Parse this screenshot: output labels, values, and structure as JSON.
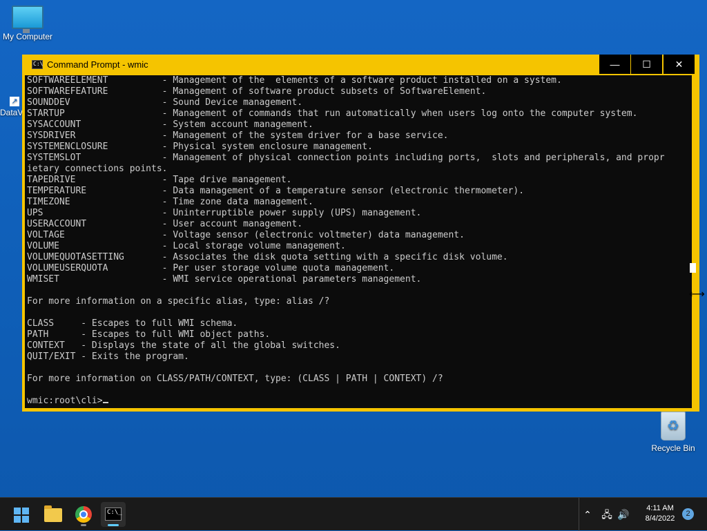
{
  "desktop": {
    "my_computer_label": "My Computer",
    "recycle_bin_label": "Recycle Bin",
    "data_label": "DataV"
  },
  "window": {
    "title": "Command Prompt - wmic",
    "minimize_glyph": "—",
    "maximize_glyph": "☐",
    "close_glyph": "✕"
  },
  "console": {
    "lines": [
      "SOFTWAREELEMENT          - Management of the  elements of a software product installed on a system.",
      "SOFTWAREFEATURE          - Management of software product subsets of SoftwareElement.",
      "SOUNDDEV                 - Sound Device management.",
      "STARTUP                  - Management of commands that run automatically when users log onto the computer system.",
      "SYSACCOUNT               - System account management.",
      "SYSDRIVER                - Management of the system driver for a base service.",
      "SYSTEMENCLOSURE          - Physical system enclosure management.",
      "SYSTEMSLOT               - Management of physical connection points including ports,  slots and peripherals, and propr",
      "ietary connections points.",
      "TAPEDRIVE                - Tape drive management.",
      "TEMPERATURE              - Data management of a temperature sensor (electronic thermometer).",
      "TIMEZONE                 - Time zone data management.",
      "UPS                      - Uninterruptible power supply (UPS) management.",
      "USERACCOUNT              - User account management.",
      "VOLTAGE                  - Voltage sensor (electronic voltmeter) data management.",
      "VOLUME                   - Local storage volume management.",
      "VOLUMEQUOTASETTING       - Associates the disk quota setting with a specific disk volume.",
      "VOLUMEUSERQUOTA          - Per user storage volume quota management.",
      "WMISET                   - WMI service operational parameters management.",
      "",
      "For more information on a specific alias, type: alias /?",
      "",
      "CLASS     - Escapes to full WMI schema.",
      "PATH      - Escapes to full WMI object paths.",
      "CONTEXT   - Displays the state of all the global switches.",
      "QUIT/EXIT - Exits the program.",
      "",
      "For more information on CLASS/PATH/CONTEXT, type: (CLASS | PATH | CONTEXT) /?",
      ""
    ],
    "prompt": "wmic:root\\cli>"
  },
  "taskbar": {
    "cmd_icon_text": "C:\\_",
    "chevron_glyph": "⌃",
    "network_glyph": "🖧",
    "volume_glyph": "🔊",
    "time": "4:11 AM",
    "date": "8/4/2022",
    "notification_count": "2"
  }
}
